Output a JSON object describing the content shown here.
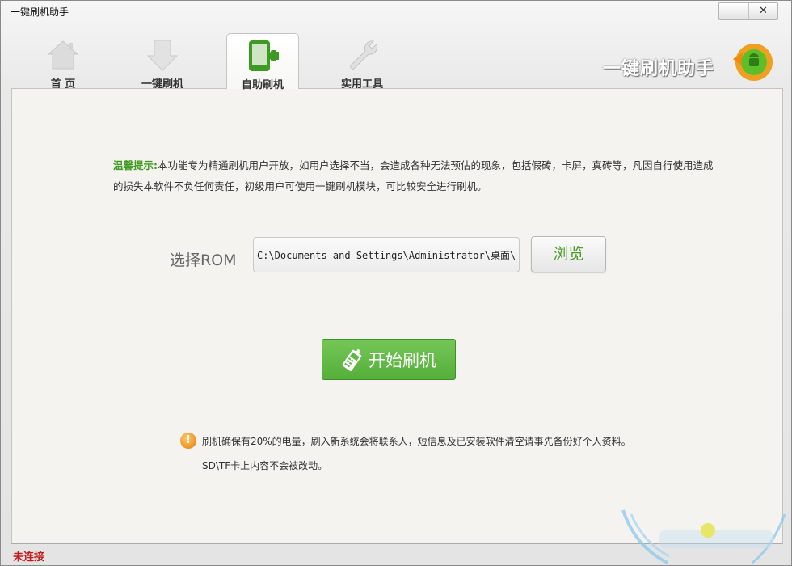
{
  "window": {
    "title": "一键刷机助手",
    "minimize_label": "—",
    "close_label": "✕"
  },
  "tabs": [
    {
      "label": "首 页",
      "icon": "home-icon",
      "selected": false
    },
    {
      "label": "一键刷机",
      "icon": "download-arrow-icon",
      "selected": false
    },
    {
      "label": "自助刷机",
      "icon": "phone-flash-icon",
      "selected": true
    },
    {
      "label": "实用工具",
      "icon": "wrench-icon",
      "selected": false
    }
  ],
  "brand": {
    "text": "一键刷机助手",
    "logo": "android-refresh-logo"
  },
  "tip": {
    "label": "温馨提示:",
    "text": "本功能专为精通刷机用户开放，如用户选择不当，会造成各种无法预估的现象，包括假砖，卡屏，真砖等，凡因自行使用造成的损失本软件不负任何责任，初级用户可使用一键刷机模块，可比较安全进行刷机。"
  },
  "rom": {
    "label": "选择ROM",
    "value": "C:\\Documents and Settings\\Administrator\\桌面\\S",
    "browse_label": "浏览"
  },
  "start_button": {
    "label": "开始刷机",
    "icon": "phone-flash-icon"
  },
  "notes": {
    "icon": "warning-icon",
    "line1": "刷机确保有20%的电量，刷入新系统会将联系人，短信息及已安装软件清空请事先备份好个人资料。",
    "line2": "SD\\TF卡上内容不会被改动。"
  },
  "status": {
    "text": "未连接",
    "color": "#c21a1a"
  },
  "colors": {
    "accent_green": "#55af3a",
    "tip_green": "#3f9b22"
  }
}
